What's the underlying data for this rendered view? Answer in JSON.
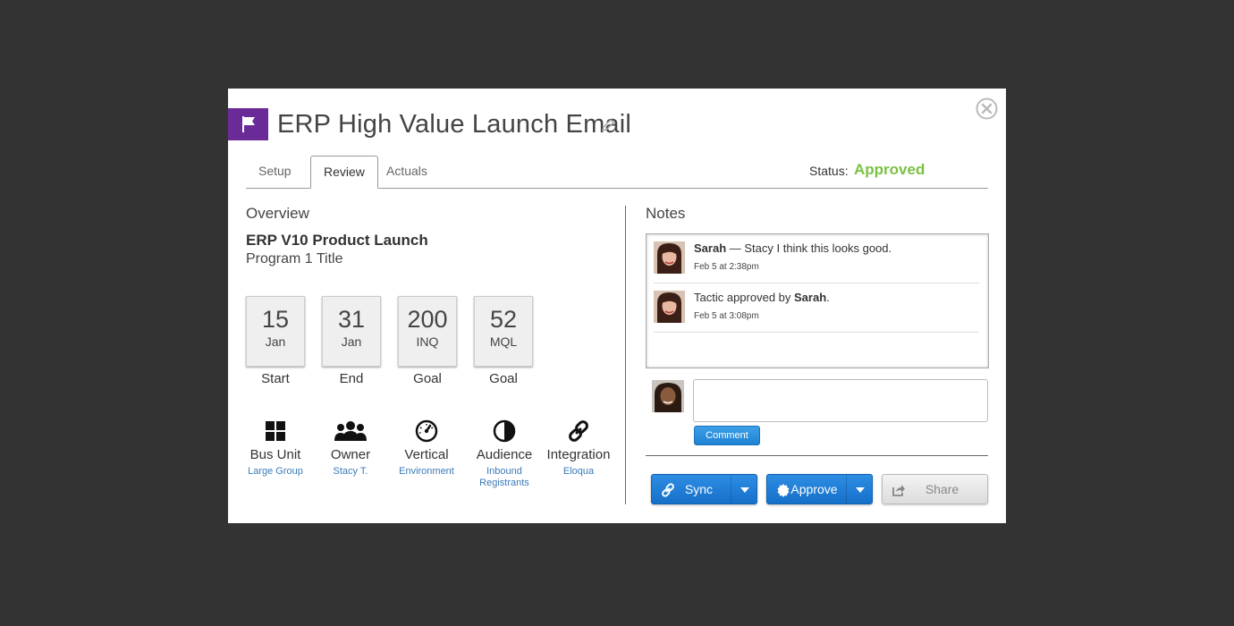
{
  "modal": {
    "title": "ERP High Value Launch Email",
    "status_label": "Status:",
    "status_value": "Approved",
    "status_color": "#7ac143",
    "flag_color": "#6a2a98"
  },
  "tabs": [
    {
      "label": "Setup",
      "active": false
    },
    {
      "label": "Review",
      "active": true
    },
    {
      "label": "Actuals",
      "active": false
    }
  ],
  "overview": {
    "heading": "Overview",
    "program_name": "ERP V10 Product Launch",
    "program_title": "Program 1 Title",
    "stats": [
      {
        "number": "15",
        "unit": "Jan",
        "label": "Start"
      },
      {
        "number": "31",
        "unit": "Jan",
        "label": "End"
      },
      {
        "number": "200",
        "unit": "INQ",
        "label": "Goal"
      },
      {
        "number": "52",
        "unit": "MQL",
        "label": "Goal"
      }
    ],
    "attributes": [
      {
        "icon": "grid-icon",
        "name": "Bus Unit",
        "value": "Large Group"
      },
      {
        "icon": "people-icon",
        "name": "Owner",
        "value": "Stacy T."
      },
      {
        "icon": "speedometer-icon",
        "name": "Vertical",
        "value": "Environment"
      },
      {
        "icon": "half-circle-icon",
        "name": "Audience",
        "value": "Inbound Registrants"
      },
      {
        "icon": "link-icon",
        "name": "Integration",
        "value": "Eloqua"
      }
    ]
  },
  "notes": {
    "heading": "Notes",
    "items": [
      {
        "author": "Sarah",
        "text_before": "",
        "text_after": " — Stacy I think this looks good.",
        "time": "Feb 5 at 2:38pm"
      },
      {
        "author": "Sarah",
        "text_before": "Tactic approved by ",
        "text_after": ".",
        "time": "Feb 5 at 3:08pm"
      }
    ],
    "comment_button": "Comment"
  },
  "actions": {
    "sync": "Sync",
    "approve": "Approve",
    "share": "Share"
  }
}
